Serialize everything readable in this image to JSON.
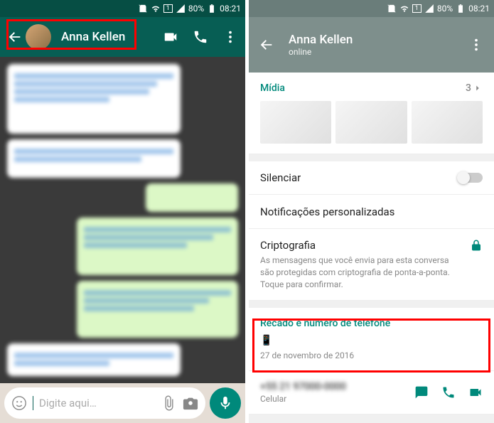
{
  "statusbar": {
    "battery": "80%",
    "time": "08:21",
    "sim": "1"
  },
  "left": {
    "contact_name": "Anna Kellen",
    "input_placeholder": "Digite aqui…"
  },
  "right": {
    "contact_name": "Anna Kellen",
    "status": "online",
    "media_label": "Mídia",
    "media_count": "3",
    "mute_label": "Silenciar",
    "custom_notif_label": "Notificações personalizadas",
    "crypto_title": "Criptografia",
    "crypto_desc": "As mensagens que você envia para esta conversa são protegidas com criptografia de ponta-a-ponta. Toque para confirmar.",
    "status_section_title": "Recado e número de telefone",
    "status_emoji": "📱",
    "status_date": "27 de novembro de 2016",
    "phone_type": "Celular"
  }
}
